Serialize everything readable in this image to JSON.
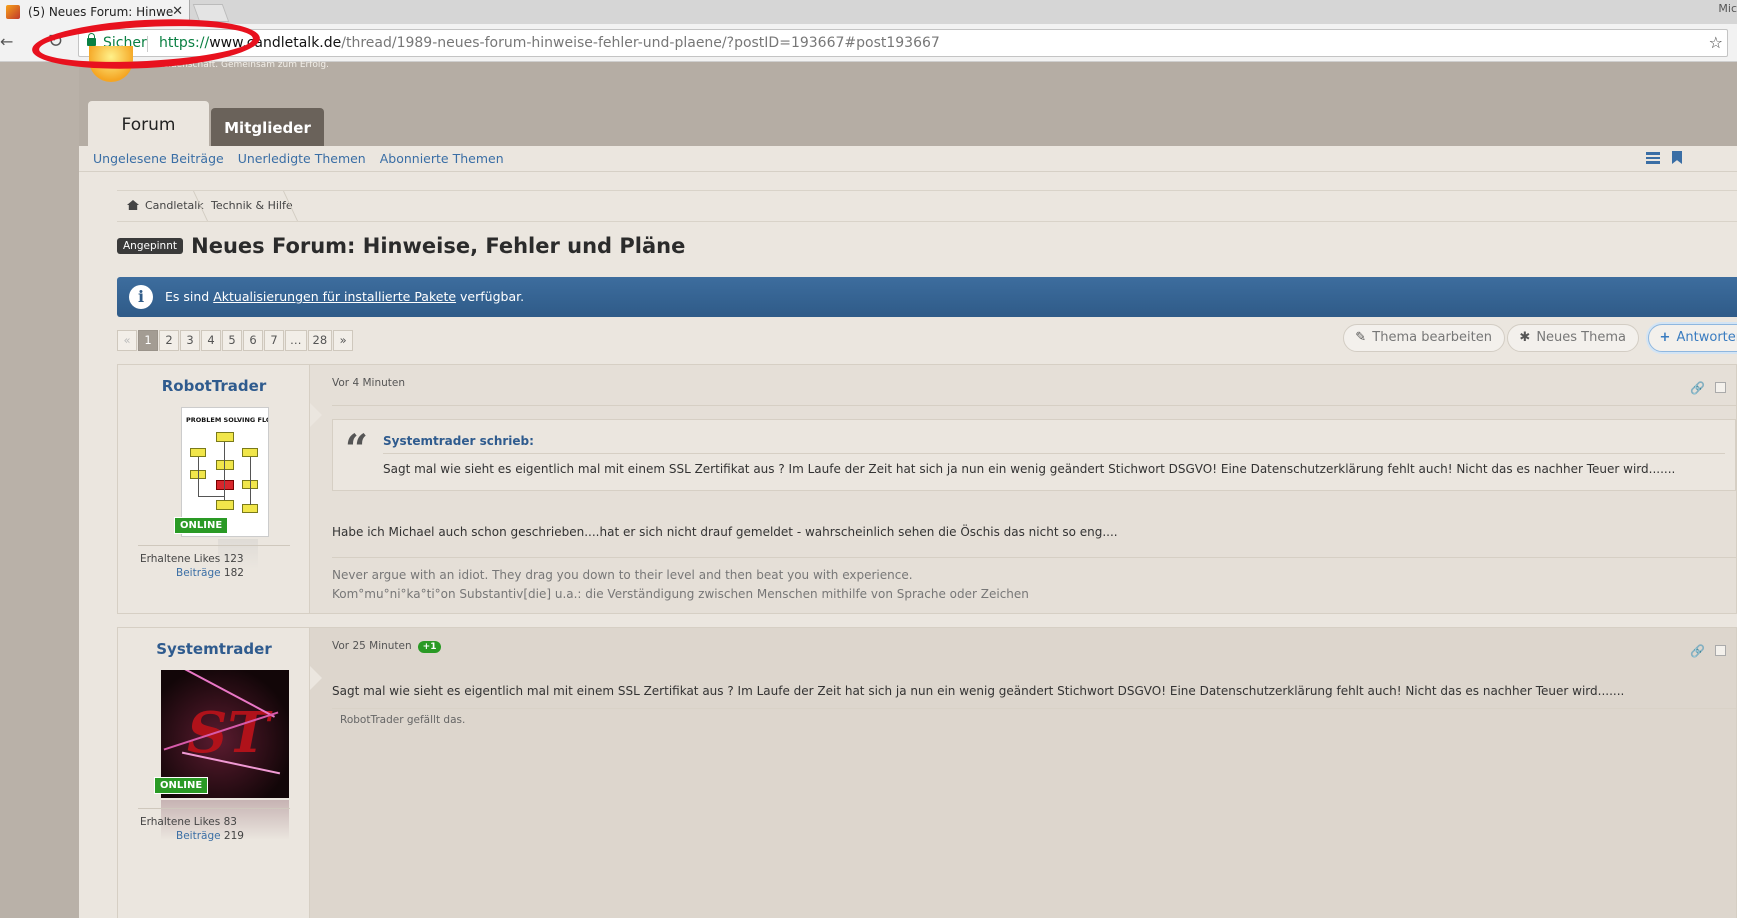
{
  "browser": {
    "tab_title": "(5) Neues Forum: Hinwe",
    "tab_close": "✕",
    "window_edge_text": "Mic",
    "secure_label": "Sicher",
    "url_scheme": "https://",
    "url_host": "www.candletalk.de",
    "url_path": "/thread/1989-neues-forum-hinweise-fehler-und-plaene/?postID=193667#post193667",
    "icons": [
      "back-icon",
      "reload-icon",
      "lock-icon",
      "star-icon"
    ]
  },
  "site": {
    "tagline": "Leidenschaft. Gemeinsam zum Erfolg.",
    "tabs": [
      {
        "label": "Forum",
        "active": true
      },
      {
        "label": "Mitglieder",
        "active": false
      }
    ],
    "subnav": [
      "Ungelesene Beiträge",
      "Unerledigte Themen",
      "Abonnierte Themen"
    ]
  },
  "breadcrumb": [
    "Candletalk",
    "Technik & Hilfe"
  ],
  "thread": {
    "pinned_label": "Angepinnt",
    "title": "Neues Forum: Hinweise, Fehler und Pläne"
  },
  "info_banner": {
    "prefix": "Es sind ",
    "link": "Aktualisierungen für installierte Pakete",
    "suffix": " verfügbar."
  },
  "pagination": {
    "prev": "«",
    "pages": [
      "1",
      "2",
      "3",
      "4",
      "5",
      "6",
      "7",
      "…",
      "28"
    ],
    "next": "»",
    "current": 1
  },
  "actions": {
    "edit_thread": "Thema bearbeiten",
    "new_thread": "Neues Thema",
    "reply": "Antworten"
  },
  "posts": [
    {
      "username": "RobotTrader",
      "online_label": "ONLINE",
      "avatar_title": "PROBLEM SOLVING FLOWCHART",
      "likes_label": "Erhaltene Likes",
      "likes": "123",
      "posts_label": "Beiträge",
      "posts": "182",
      "time": "Vor 4 Minuten",
      "quote_author": "Systemtrader schrieb:",
      "quote_text": "Sagt mal wie sieht es eigentlich mal mit einem SSL Zertifikat aus ? Im Laufe der Zeit hat sich ja nun ein wenig geändert Stichwort DSGVO! Eine Datenschutzerklärung fehlt auch! Nicht das es nachher Teuer wird.......",
      "message": "Habe ich Michael auch schon geschrieben....hat er sich nicht drauf gemeldet - wahrscheinlich sehen die Öschis das nicht so eng....",
      "signature_line1": "Never argue with an idiot. They drag you down to their level and then beat you with experience.",
      "signature_line2": "Kom°mu°ni°ka°ti°on Substantiv[die] u.a.: die Verständigung zwischen Menschen mithilfe von Sprache oder Zeichen"
    },
    {
      "username": "Systemtrader",
      "online_label": "ONLINE",
      "avatar_text": "ST",
      "likes_label": "Erhaltene Likes",
      "likes": "83",
      "posts_label": "Beiträge",
      "posts": "219",
      "time": "Vor 25 Minuten",
      "like_badge": "+1",
      "message": "Sagt mal wie sieht es eigentlich mal mit einem SSL Zertifikat aus ? Im Laufe der Zeit hat sich ja nun ein wenig geändert Stichwort DSGVO! Eine Datenschutzerklärung fehlt auch! Nicht das es nachher Teuer wird.......",
      "liked_by": "RobotTrader gefällt das."
    }
  ],
  "colors": {
    "link": "#3a6ea5",
    "secure_green": "#0b8043",
    "online_green": "#2a9a25",
    "banner_blue": "#2f5b88",
    "highlight_red": "#e8111e"
  }
}
